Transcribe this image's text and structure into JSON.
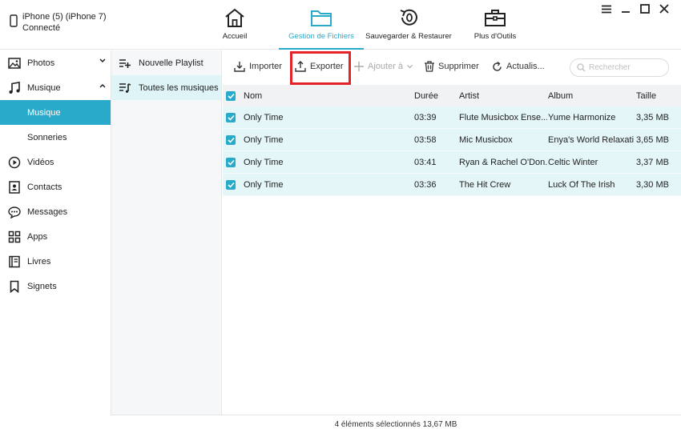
{
  "device": {
    "name": "iPhone (5) (iPhone 7)",
    "status": "Connecté"
  },
  "nav": {
    "tabs": [
      {
        "label": "Accueil",
        "icon": "home-icon"
      },
      {
        "label": "Gestion de Fichiers",
        "icon": "folder-icon",
        "active": true
      },
      {
        "label": "Sauvegarder & Restaurer",
        "icon": "backup-restore-icon"
      },
      {
        "label": "Plus d'Outils",
        "icon": "toolbox-icon"
      }
    ]
  },
  "sidebar": {
    "items": [
      {
        "label": "Photos",
        "icon": "photo-icon",
        "chevron": "down"
      },
      {
        "label": "Musique",
        "icon": "music-note-icon",
        "chevron": "up"
      },
      {
        "label": "Musique",
        "sub": true,
        "active": true
      },
      {
        "label": "Sonneries",
        "sub": true
      },
      {
        "label": "Vidéos",
        "icon": "play-circle-icon"
      },
      {
        "label": "Contacts",
        "icon": "contact-card-icon"
      },
      {
        "label": "Messages",
        "icon": "chat-bubble-icon"
      },
      {
        "label": "Apps",
        "icon": "apps-grid-icon"
      },
      {
        "label": "Livres",
        "icon": "book-icon"
      },
      {
        "label": "Signets",
        "icon": "bookmark-icon"
      }
    ]
  },
  "playlists": {
    "items": [
      {
        "label": "Nouvelle Playlist",
        "icon": "add-playlist-icon"
      },
      {
        "label": "Toutes les musiques",
        "icon": "playlist-music-icon",
        "active": true
      }
    ]
  },
  "toolbar": {
    "importer": "Importer",
    "exporter": "Exporter",
    "ajouter": "Ajouter à",
    "supprimer": "Supprimer",
    "actualiser": "Actualis...",
    "search_placeholder": "Rechercher"
  },
  "table": {
    "headers": {
      "nom": "Nom",
      "duree": "Durée",
      "artist": "Artist",
      "album": "Album",
      "taille": "Taille"
    },
    "rows": [
      {
        "nom": "Only Time",
        "duree": "03:39",
        "artist": "Flute Musicbox Ense...",
        "album": "Yume Harmonize",
        "taille": "3,35 MB",
        "checked": true
      },
      {
        "nom": "Only Time",
        "duree": "03:58",
        "artist": "Mic Musicbox",
        "album": "Enya's World Relaxati...",
        "taille": "3,65 MB",
        "checked": true
      },
      {
        "nom": "Only Time",
        "duree": "03:41",
        "artist": "Ryan & Rachel O'Don...",
        "album": "Celtic Winter",
        "taille": "3,37 MB",
        "checked": true
      },
      {
        "nom": "Only Time",
        "duree": "03:36",
        "artist": "The Hit Crew",
        "album": "Luck Of The Irish",
        "taille": "3,30 MB",
        "checked": true
      }
    ]
  },
  "status_bar": {
    "text": "4 éléments sélectionnés 13,67 MB"
  },
  "colors": {
    "accent": "#29aacb",
    "highlight": "#e2242a",
    "row_selected": "#e4f6f8"
  }
}
